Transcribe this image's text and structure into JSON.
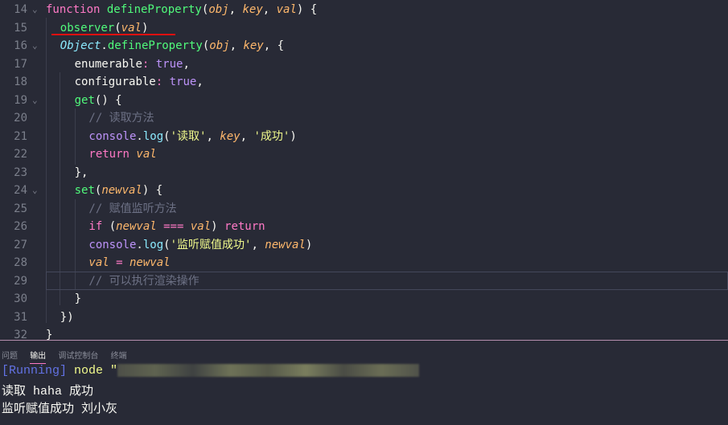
{
  "editor": {
    "lines": [
      {
        "n": "14",
        "fold": true,
        "ind": 0,
        "t": [
          [
            "kw",
            "function "
          ],
          [
            "fn",
            "defineProperty"
          ],
          [
            "pl",
            "("
          ],
          [
            "pa",
            "obj"
          ],
          [
            "pl",
            ", "
          ],
          [
            "pa",
            "key"
          ],
          [
            "pl",
            ", "
          ],
          [
            "pa",
            "val"
          ],
          [
            "pl",
            ") {"
          ]
        ]
      },
      {
        "n": "15",
        "fold": false,
        "ind": 1,
        "t": [
          [
            "fn",
            "observer"
          ],
          [
            "pl",
            "("
          ],
          [
            "pa",
            "val"
          ],
          [
            "pl",
            ")"
          ]
        ]
      },
      {
        "n": "16",
        "fold": true,
        "ind": 1,
        "t": [
          [
            "cl",
            "Object"
          ],
          [
            "pl",
            "."
          ],
          [
            "fn",
            "defineProperty"
          ],
          [
            "pl",
            "("
          ],
          [
            "pa",
            "obj"
          ],
          [
            "pl",
            ", "
          ],
          [
            "pa",
            "key"
          ],
          [
            "pl",
            ", {"
          ]
        ]
      },
      {
        "n": "17",
        "fold": false,
        "ind": 2,
        "t": [
          [
            "pl",
            "enumerable"
          ],
          [
            "kw",
            ": "
          ],
          [
            "bo",
            "true"
          ],
          [
            "pl",
            ","
          ]
        ]
      },
      {
        "n": "18",
        "fold": false,
        "ind": 2,
        "t": [
          [
            "pl",
            "configurable"
          ],
          [
            "kw",
            ": "
          ],
          [
            "bo",
            "true"
          ],
          [
            "pl",
            ","
          ]
        ]
      },
      {
        "n": "19",
        "fold": true,
        "ind": 2,
        "t": [
          [
            "fn",
            "get"
          ],
          [
            "pl",
            "() {"
          ]
        ]
      },
      {
        "n": "20",
        "fold": false,
        "ind": 3,
        "t": [
          [
            "co",
            "// 读取方法"
          ]
        ]
      },
      {
        "n": "21",
        "fold": false,
        "ind": 3,
        "t": [
          [
            "cn",
            "console"
          ],
          [
            "pl",
            "."
          ],
          [
            "me",
            "log"
          ],
          [
            "pl",
            "("
          ],
          [
            "st",
            "'读取'"
          ],
          [
            "pl",
            ", "
          ],
          [
            "pa",
            "key"
          ],
          [
            "pl",
            ", "
          ],
          [
            "st",
            "'成功'"
          ],
          [
            "pl",
            ")"
          ]
        ]
      },
      {
        "n": "22",
        "fold": false,
        "ind": 3,
        "t": [
          [
            "kw",
            "return "
          ],
          [
            "pa",
            "val"
          ]
        ]
      },
      {
        "n": "23",
        "fold": false,
        "ind": 2,
        "t": [
          [
            "pl",
            "},"
          ]
        ]
      },
      {
        "n": "24",
        "fold": true,
        "ind": 2,
        "t": [
          [
            "fn",
            "set"
          ],
          [
            "pl",
            "("
          ],
          [
            "pa",
            "newval"
          ],
          [
            "pl",
            ") {"
          ]
        ]
      },
      {
        "n": "25",
        "fold": false,
        "ind": 3,
        "t": [
          [
            "co",
            "// 赋值监听方法"
          ]
        ]
      },
      {
        "n": "26",
        "fold": false,
        "ind": 3,
        "t": [
          [
            "kw",
            "if "
          ],
          [
            "pl",
            "("
          ],
          [
            "pa",
            "newval"
          ],
          [
            "kw",
            " === "
          ],
          [
            "pa",
            "val"
          ],
          [
            "pl",
            ") "
          ],
          [
            "kw",
            "return"
          ]
        ]
      },
      {
        "n": "27",
        "fold": false,
        "ind": 3,
        "t": [
          [
            "cn",
            "console"
          ],
          [
            "pl",
            "."
          ],
          [
            "me",
            "log"
          ],
          [
            "pl",
            "("
          ],
          [
            "st",
            "'监听赋值成功'"
          ],
          [
            "pl",
            ", "
          ],
          [
            "pa",
            "newval"
          ],
          [
            "pl",
            ")"
          ]
        ]
      },
      {
        "n": "28",
        "fold": false,
        "ind": 3,
        "t": [
          [
            "pa",
            "val"
          ],
          [
            "kw",
            " = "
          ],
          [
            "pa",
            "newval"
          ]
        ]
      },
      {
        "n": "29",
        "fold": false,
        "ind": 3,
        "t": [
          [
            "co",
            "// 可以执行渲染操作"
          ]
        ]
      },
      {
        "n": "30",
        "fold": false,
        "ind": 2,
        "t": [
          [
            "pl",
            "}"
          ]
        ]
      },
      {
        "n": "31",
        "fold": false,
        "ind": 1,
        "t": [
          [
            "pl",
            "})"
          ]
        ]
      },
      {
        "n": "32",
        "fold": false,
        "ind": 0,
        "t": [
          [
            "pl",
            "}"
          ]
        ]
      }
    ]
  },
  "panel": {
    "tabs": [
      "问题",
      "输出",
      "调试控制台",
      "终端"
    ],
    "active": 1,
    "running": "[Running]",
    "cmd": "node \"",
    "path_tail": "\\Object.defineProperty.js\"",
    "output": [
      "读取 haha 成功",
      "监听赋值成功 刘小灰"
    ]
  },
  "colors": {
    "background": "#282a36",
    "keyword": "#ff79c6",
    "function": "#50fa7b",
    "string": "#f1fa8c",
    "param": "#ffb86c"
  }
}
